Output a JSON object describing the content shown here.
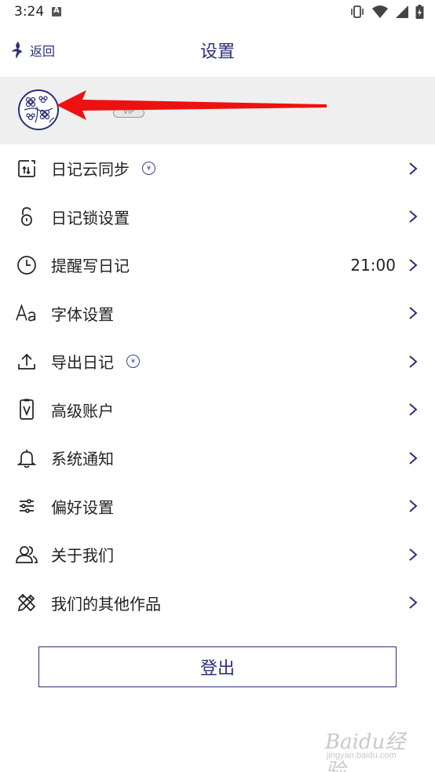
{
  "status_bar": {
    "time": "3:24",
    "notification_letter": "A"
  },
  "header": {
    "back_label": "返回",
    "title": "设置"
  },
  "profile": {
    "badge": "VIP"
  },
  "menu": [
    {
      "label": "日记云同步",
      "icon": "cloud-sync-icon",
      "coin": true,
      "value": ""
    },
    {
      "label": "日记锁设置",
      "icon": "lock-icon",
      "coin": false,
      "value": ""
    },
    {
      "label": "提醒写日记",
      "icon": "clock-icon",
      "coin": false,
      "value": "21:00"
    },
    {
      "label": "字体设置",
      "icon": "font-icon",
      "coin": false,
      "value": ""
    },
    {
      "label": "导出日记",
      "icon": "export-icon",
      "coin": true,
      "value": ""
    },
    {
      "label": "高级账户",
      "icon": "premium-account-icon",
      "coin": false,
      "value": ""
    },
    {
      "label": "系统通知",
      "icon": "bell-icon",
      "coin": false,
      "value": ""
    },
    {
      "label": "偏好设置",
      "icon": "sliders-icon",
      "coin": false,
      "value": ""
    },
    {
      "label": "关于我们",
      "icon": "users-icon",
      "coin": false,
      "value": ""
    },
    {
      "label": "我们的其他作品",
      "icon": "pencil-ruler-icon",
      "coin": false,
      "value": ""
    }
  ],
  "coin_glyph": "¥",
  "logout_label": "登出",
  "watermark": {
    "logo": "Baidu经验",
    "sub": "jingyan.baidu.com"
  },
  "colors": {
    "accent": "#2c2f7a",
    "profile_bg": "#efefef",
    "arrow": "#ee1111"
  }
}
